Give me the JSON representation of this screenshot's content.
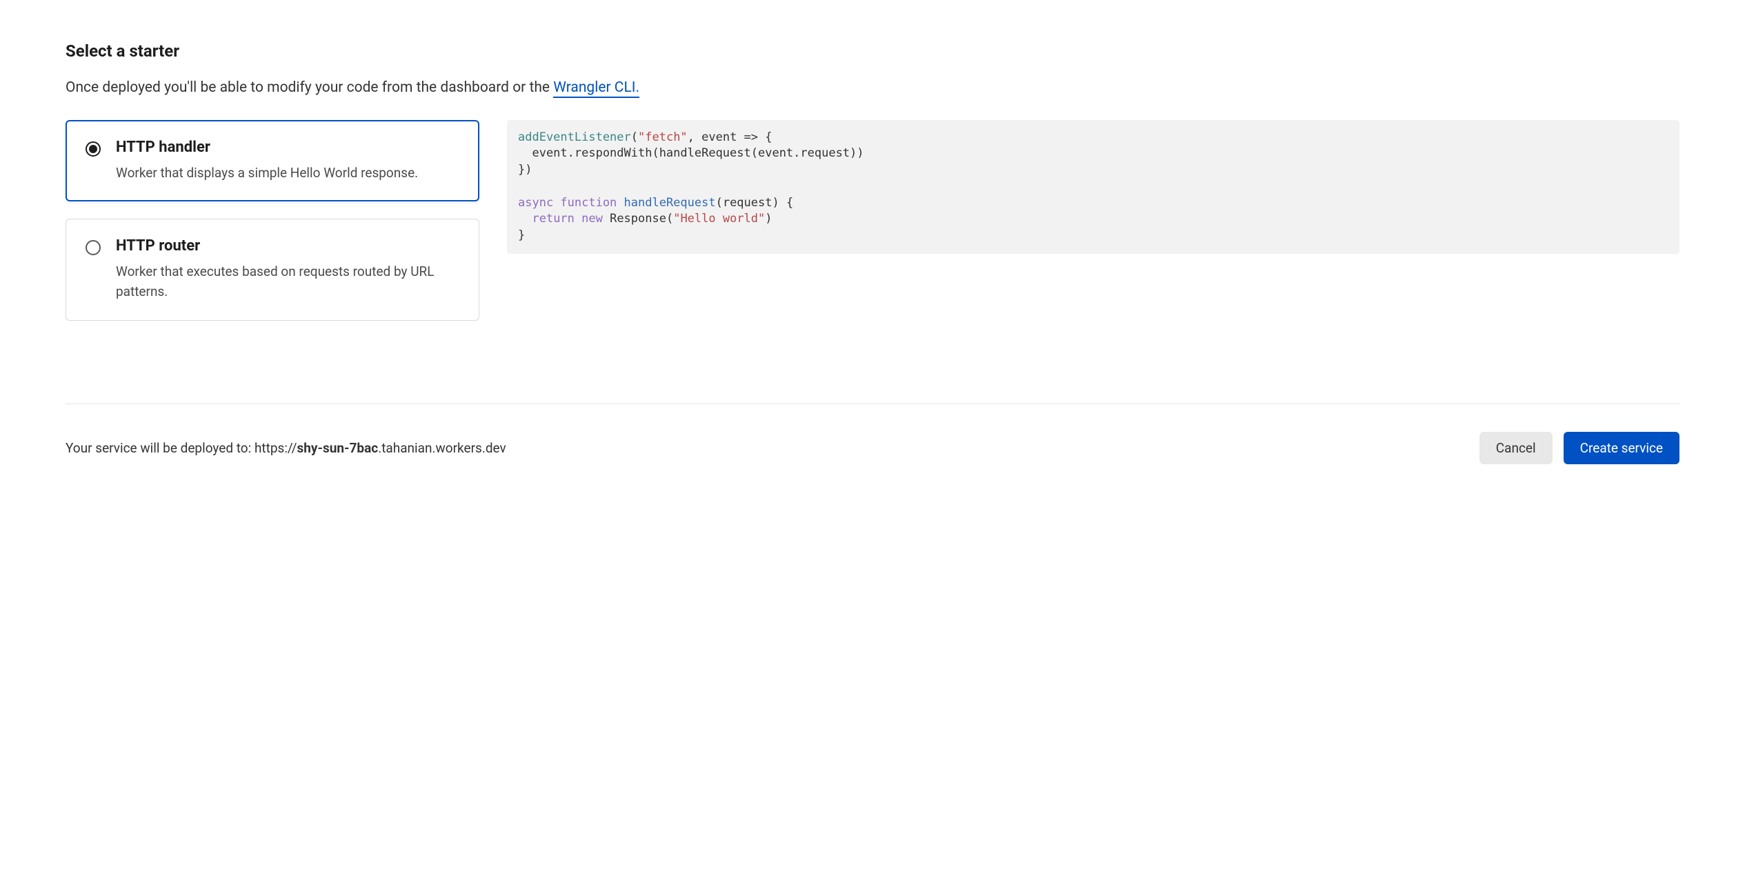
{
  "section": {
    "title": "Select a starter",
    "desc_prefix": "Once deployed you'll be able to modify your code from the dashboard or the ",
    "desc_link": "Wrangler CLI."
  },
  "starters": [
    {
      "id": "http-handler",
      "title": "HTTP handler",
      "desc": "Worker that displays a simple Hello World response.",
      "selected": true
    },
    {
      "id": "http-router",
      "title": "HTTP router",
      "desc": "Worker that executes based on requests routed by URL patterns.",
      "selected": false
    }
  ],
  "code": {
    "l1_fn": "addEventListener",
    "l1_paren_open": "(",
    "l1_str": "\"fetch\"",
    "l1_after": ", event => {",
    "l2": "  event.respondWith(handleRequest(event.request))",
    "l3": "})",
    "l5_kw": "async function",
    "l5_fn": " handleRequest",
    "l5_after": "(request) {",
    "l6_indent": "  ",
    "l6_kw": "return new",
    "l6_after_kw": " Response(",
    "l6_str": "\"Hello world\"",
    "l6_close": ")",
    "l7": "}"
  },
  "footer": {
    "deploy_prefix": "Your service will be deployed to: https://",
    "deploy_bold": "shy-sun-7bac",
    "deploy_suffix": ".tahanian.workers.dev",
    "cancel_label": "Cancel",
    "create_label": "Create service"
  }
}
